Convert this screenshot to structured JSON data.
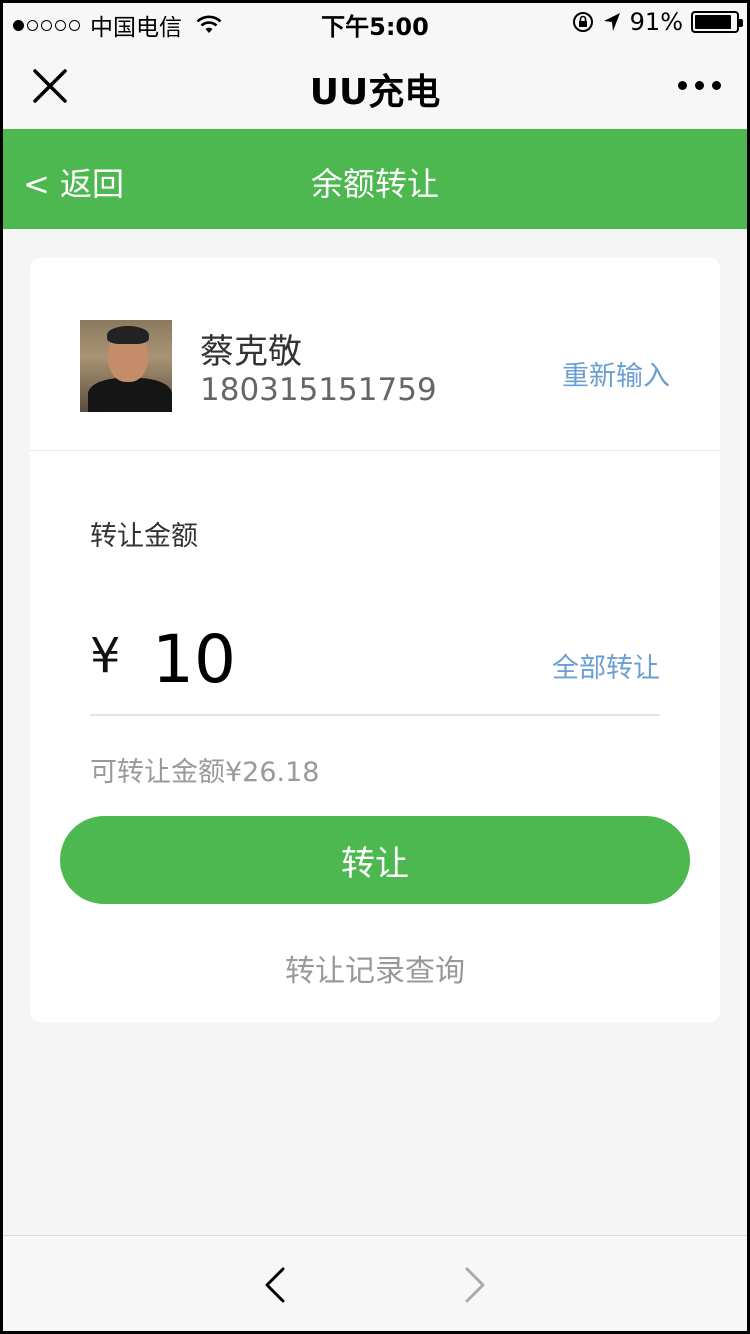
{
  "status_bar": {
    "carrier": "中国电信",
    "time": "下午5:00",
    "battery_text": "91%",
    "battery_level": 0.91,
    "signal_bars_filled": 1
  },
  "wechat_header": {
    "title": "UU充电",
    "close_icon": "close-icon",
    "more_icon": "more-icon"
  },
  "nav": {
    "back_label": "< 返回",
    "title": "余额转让",
    "color": "#4cb84f"
  },
  "recipient": {
    "name": "蔡克敬",
    "phone": "180315151759",
    "reenter_label": "重新输入"
  },
  "transfer": {
    "amount_label": "转让金额",
    "currency_symbol": "¥",
    "amount_value": "10",
    "transfer_all_label": "全部转让",
    "available_text": "可转让金额¥26.18",
    "submit_label": "转让",
    "history_label": "转让记录查询"
  },
  "colors": {
    "accent": "#4cb84f",
    "link": "#6a9fd4"
  }
}
